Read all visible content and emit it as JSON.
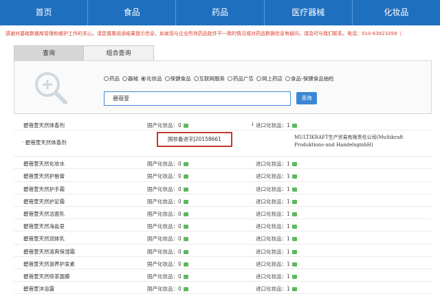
{
  "nav": {
    "items": [
      "首页",
      "食品",
      "药品",
      "医疗器械",
      "化妆品"
    ]
  },
  "notice": "感谢对基础数据库管理和维护工作的关心，请您慎重阅读结果提示信息，如发现与企业所持药品批件不一致的情况或对药品数据信息有疑问，请及时与我们联系。电话：010-63923358（",
  "tabs": [
    "查询",
    "组合查询"
  ],
  "search": {
    "options": [
      "药品",
      "器械",
      "化妆品",
      "保健食品",
      "互联网服务",
      "药品广告",
      "网上药店",
      "食品-保健食品抽检"
    ],
    "selected_index": 2,
    "query": "碧蓓萱",
    "button_label": "查询"
  },
  "results": {
    "first": {
      "name": "碧蓓萱天然体香剂",
      "domestic": "国产化妆品：0",
      "imported": "进口化妆品：1"
    },
    "detail": {
      "sub_name": "碧蓓萱天然体香剂",
      "registration": "国妆备进字J20158661",
      "company": "MULTIKRAFT生产贸易有限责任公司(Multikraft Produktions-und HandelsgmbH)"
    },
    "rows": [
      {
        "name": "碧蓓萱天然化妆水",
        "domestic": "国产化妆品：0",
        "imported": "进口化妆品：1"
      },
      {
        "name": "碧蓓萱天然护唇膏",
        "domestic": "国产化妆品：0",
        "imported": "进口化妆品：1"
      },
      {
        "name": "碧蓓萱天然护手霜",
        "domestic": "国产化妆品：0",
        "imported": "进口化妆品：1"
      },
      {
        "name": "碧蓓萱天然护足霜",
        "domestic": "国产化妆品：0",
        "imported": "进口化妆品：1"
      },
      {
        "name": "碧蓓萱天然洁面乳",
        "domestic": "国产化妆品：0",
        "imported": "进口化妆品：1"
      },
      {
        "name": "碧蓓萱天然海盐皂",
        "domestic": "国产化妆品：0",
        "imported": "进口化妆品：1"
      },
      {
        "name": "碧蓓萱天然润体乳",
        "domestic": "国产化妆品：0",
        "imported": "进口化妆品：1"
      },
      {
        "name": "碧蓓萱天然清爽保湿霜",
        "domestic": "国产化妆品：0",
        "imported": "进口化妆品：1"
      },
      {
        "name": "碧蓓萱天然滋养护发素",
        "domestic": "国产化妆品：0",
        "imported": "进口化妆品：1"
      },
      {
        "name": "碧蓓萱天然修茶面膜",
        "domestic": "国产化妆品：0",
        "imported": "进口化妆品：1"
      },
      {
        "name": "碧蓓萱沐浴露",
        "domestic": "国产化妆品：0",
        "imported": "进口化妆品：1"
      }
    ]
  },
  "colors": {
    "nav_bg": "#1f6fbf",
    "notice_text": "#d63b2e",
    "badge": "#5cb85c",
    "highlight_box": "#c0392b",
    "button": "#3a86d4"
  },
  "icons": {
    "search_panel": "magnifier-plus-icon",
    "count_badge": "green-badge-icon",
    "expand": "down-arrow-icon"
  }
}
